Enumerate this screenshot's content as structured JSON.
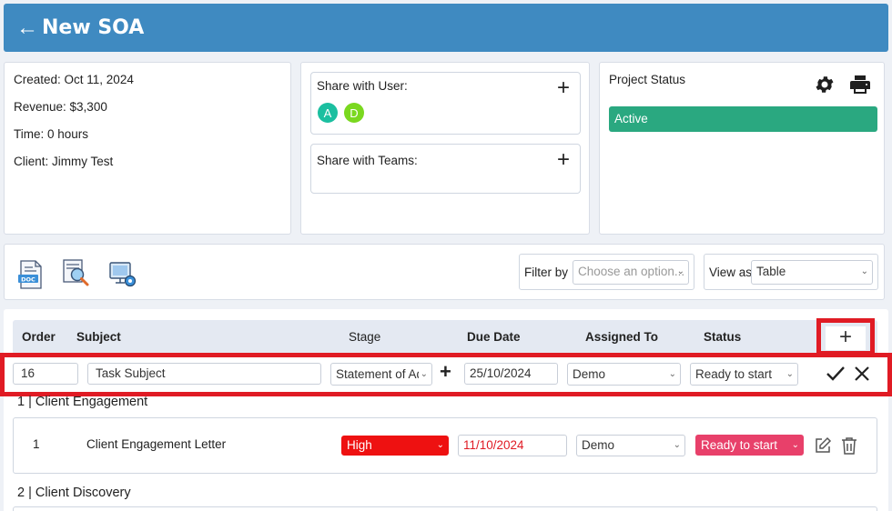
{
  "header": {
    "back_icon": "arrow-left-icon",
    "title": "New SOA"
  },
  "info": {
    "created": "Created: Oct 11, 2024",
    "revenue": "Revenue: $3,300",
    "time": "Time: 0 hours",
    "client": "Client: Jimmy Test"
  },
  "share": {
    "user_label": "Share with User:",
    "users": [
      {
        "initial": "A",
        "color": "#1bbfa0"
      },
      {
        "initial": "D",
        "color": "#7ad81f"
      }
    ],
    "teams_label": "Share with Teams:"
  },
  "project_status": {
    "label": "Project Status",
    "value": "Active",
    "color": "#2aa880"
  },
  "toolbar": {
    "filter_label": "Filter by",
    "filter_placeholder": "Choose an option...",
    "view_label": "View as",
    "view_value": "Table"
  },
  "table": {
    "headers": {
      "order": "Order",
      "subject": "Subject",
      "stage": "Stage",
      "due_date": "Due Date",
      "assigned_to": "Assigned To",
      "status": "Status"
    },
    "new_row": {
      "order": "16",
      "subject_placeholder": "Task Subject",
      "stage": "Statement of Ad",
      "due_date": "25/10/2024",
      "assigned": "Demo",
      "status": "Ready to start"
    },
    "groups": [
      {
        "title": "1 | Client Engagement",
        "rows": [
          {
            "order": "1",
            "subject": "Client Engagement Letter",
            "stage": "High",
            "due_date": "11/10/2024",
            "assigned": "Demo",
            "status": "Ready to start"
          }
        ]
      },
      {
        "title": "2 | Client Discovery",
        "rows": []
      }
    ]
  },
  "colors": {
    "header": "#3f8ac1",
    "highlight": "#e01b24",
    "priority_high": "#ee1111",
    "status_ready": "#e8406a"
  }
}
